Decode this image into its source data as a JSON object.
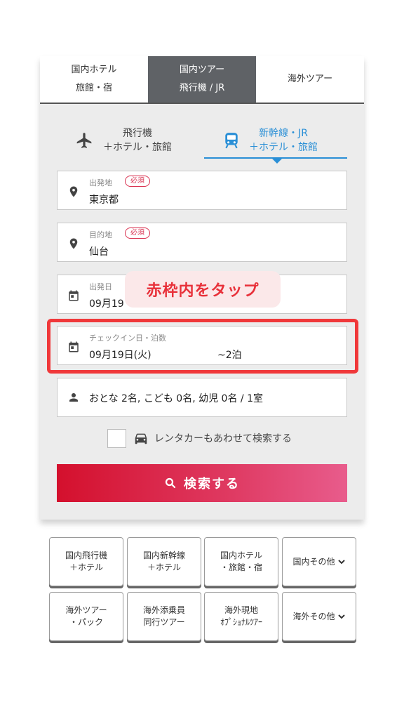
{
  "top_tabs": [
    {
      "line1": "国内ホテル",
      "line2": "旅館・宿",
      "active": false
    },
    {
      "line1": "国内ツアー",
      "line2": "飛行機 / JR",
      "active": true
    },
    {
      "line1": "海外ツアー",
      "line2": "",
      "active": false
    }
  ],
  "sub_tabs": {
    "plane": {
      "line1": "飛行機",
      "line2": "＋ホテル・旅館"
    },
    "train": {
      "line1": "新幹線・JR",
      "line2": "＋ホテル・旅館"
    }
  },
  "form": {
    "required_badge": "必須",
    "departure": {
      "label": "出発地",
      "value": "東京都"
    },
    "destination": {
      "label": "目的地",
      "value": "仙台"
    },
    "departure_date": {
      "label": "出発日",
      "value": "09月19"
    },
    "checkin": {
      "label": "チェックイン日・泊数",
      "value": "09月19日(火)",
      "nights": "~2泊"
    },
    "passengers": {
      "value": "おとな 2名, こども 0名, 幼児 0名 / 1室"
    },
    "rental_car_label": "レンタカーもあわせて検索する",
    "search_button": "検索する"
  },
  "callout": "赤枠内をタップ",
  "quick_links": [
    {
      "line1": "国内飛行機",
      "line2": "＋ホテル",
      "chevron": false
    },
    {
      "line1": "国内新幹線",
      "line2": "＋ホテル",
      "chevron": false
    },
    {
      "line1": "国内ホテル",
      "line2": "・旅館・宿",
      "chevron": false
    },
    {
      "line1": "国内その他",
      "line2": "",
      "chevron": true
    },
    {
      "line1": "海外ツアー",
      "line2": "・パック",
      "chevron": false
    },
    {
      "line1": "海外添乗員",
      "line2": "同行ツアー",
      "chevron": false
    },
    {
      "line1": "海外現地",
      "line2": "ｵﾌﾟｼｮﾅﾙﾂｱｰ",
      "chevron": false
    },
    {
      "line1": "海外その他",
      "line2": "",
      "chevron": true
    }
  ],
  "colors": {
    "accent_blue": "#2a8fd6",
    "highlight_red": "#f0383a",
    "button_red": "#d4102d",
    "active_tab": "#5f6266"
  }
}
